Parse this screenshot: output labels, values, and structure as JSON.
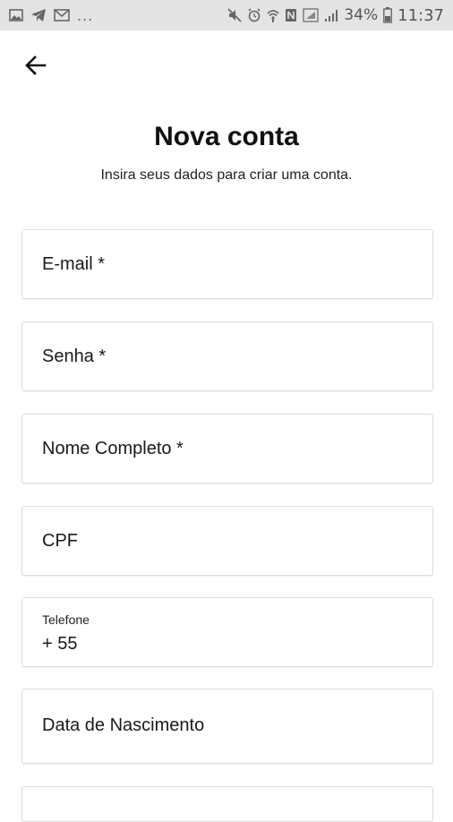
{
  "status_bar": {
    "icons_left": [
      "image-icon",
      "telegram-icon",
      "gmail-icon"
    ],
    "ellipsis": "...",
    "icons_right": [
      "mute-icon",
      "alarm-icon",
      "wifi-icon",
      "nfc-icon",
      "signal-icon",
      "signal-bars-icon",
      "battery-icon"
    ],
    "battery": "34%",
    "time": "11:37"
  },
  "header": {
    "back_icon": "arrow-left-icon",
    "title": "Nova conta",
    "subtitle": "Insira seus dados para criar uma conta."
  },
  "form": {
    "email": {
      "placeholder": "E-mail *"
    },
    "password": {
      "placeholder": "Senha *"
    },
    "full_name": {
      "placeholder": "Nome Completo *"
    },
    "cpf": {
      "placeholder": "CPF"
    },
    "phone": {
      "label": "Telefone",
      "value": "+ 55"
    },
    "birth_date": {
      "placeholder": "Data de Nascimento"
    }
  }
}
